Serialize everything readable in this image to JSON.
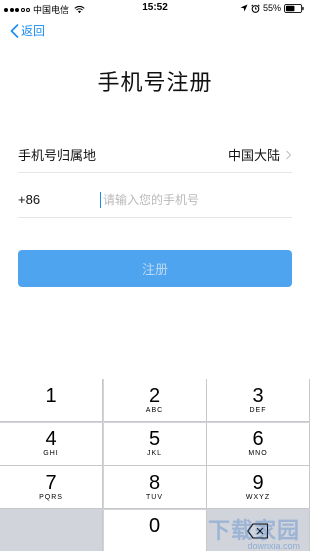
{
  "status_bar": {
    "carrier": "中国电信",
    "time": "15:52",
    "battery": "55%"
  },
  "nav": {
    "back_label": "返回"
  },
  "page": {
    "title": "手机号注册"
  },
  "form": {
    "region_label": "手机号归属地",
    "region_value": "中国大陆",
    "country_code": "+86",
    "phone_placeholder": "请输入您的手机号",
    "phone_value": ""
  },
  "register_button": {
    "label": "注册"
  },
  "keypad": {
    "keys": [
      {
        "num": "1",
        "letters": ""
      },
      {
        "num": "2",
        "letters": "ABC"
      },
      {
        "num": "3",
        "letters": "DEF"
      },
      {
        "num": "4",
        "letters": "GHI"
      },
      {
        "num": "5",
        "letters": "JKL"
      },
      {
        "num": "6",
        "letters": "MNO"
      },
      {
        "num": "7",
        "letters": "PQRS"
      },
      {
        "num": "8",
        "letters": "TUV"
      },
      {
        "num": "9",
        "letters": "WXYZ"
      },
      {
        "num": "0",
        "letters": ""
      }
    ]
  },
  "colors": {
    "accent": "#1a8cf0",
    "button_bg": "#4ea4ee",
    "keypad_bg": "#d1d5db"
  },
  "watermark": {
    "text": "下载家园",
    "sub": "downxia.com"
  }
}
